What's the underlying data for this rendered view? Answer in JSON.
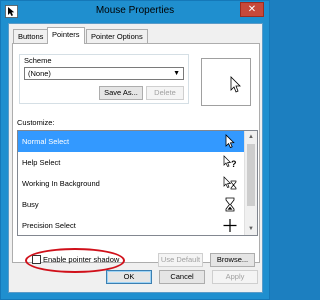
{
  "window": {
    "title": "Mouse Properties",
    "close_glyph": "✕"
  },
  "tabs": [
    {
      "label": "Buttons",
      "active": false
    },
    {
      "label": "Pointers",
      "active": true
    },
    {
      "label": "Pointer Options",
      "active": false
    }
  ],
  "scheme": {
    "label": "Scheme",
    "value": "(None)",
    "save_as_label": "Save As...",
    "delete_label": "Delete"
  },
  "customize": {
    "label": "Customize:",
    "items": [
      {
        "label": "Normal Select",
        "icon": "arrow-cursor-icon",
        "selected": true
      },
      {
        "label": "Help Select",
        "icon": "help-cursor-icon",
        "selected": false
      },
      {
        "label": "Working In Background",
        "icon": "working-cursor-icon",
        "selected": false
      },
      {
        "label": "Busy",
        "icon": "busy-cursor-icon",
        "selected": false
      },
      {
        "label": "Precision Select",
        "icon": "crosshair-cursor-icon",
        "selected": false
      }
    ]
  },
  "pointer_shadow": {
    "label": "Enable pointer shadow",
    "checked": false
  },
  "buttons": {
    "use_default": "Use Default",
    "browse": "Browse...",
    "ok": "OK",
    "cancel": "Cancel",
    "apply": "Apply"
  },
  "colors": {
    "selection": "#3399ff",
    "annotation": "#d0101a",
    "titlebar": "#1f8fcf",
    "close": "#c7493a"
  }
}
